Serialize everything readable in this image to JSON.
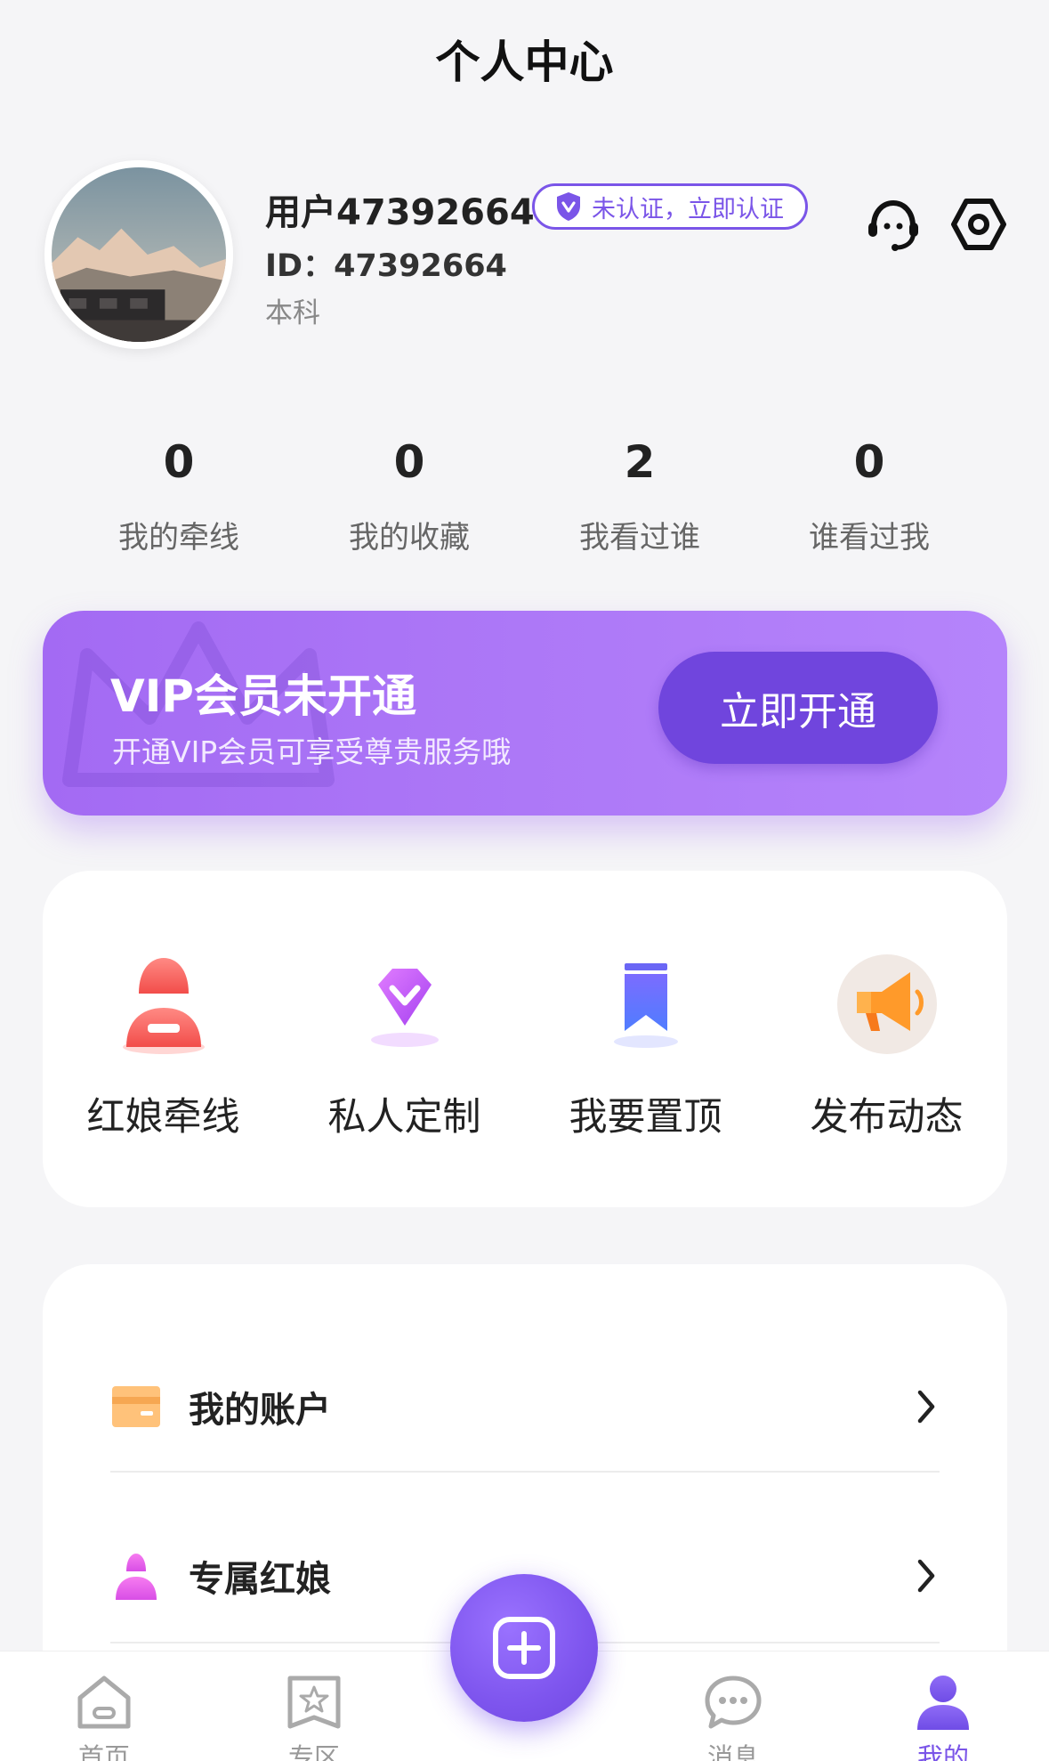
{
  "header": {
    "title": "个人中心"
  },
  "profile": {
    "name": "用户47392664",
    "verify_label": "未认证，立即认证",
    "id_text": "ID：47392664",
    "education": "本科"
  },
  "stats": [
    {
      "value": "0",
      "label": "我的牵线"
    },
    {
      "value": "0",
      "label": "我的收藏"
    },
    {
      "value": "2",
      "label": "我看过谁"
    },
    {
      "value": "0",
      "label": "谁看过我"
    }
  ],
  "vip": {
    "title": "VIP会员未开通",
    "subtitle": "开通VIP会员可享受尊贵服务哦",
    "button_label": "立即开通"
  },
  "quick_actions": [
    {
      "label": "红娘牵线",
      "icon": "matchmaker-icon"
    },
    {
      "label": "私人定制",
      "icon": "diamond-icon"
    },
    {
      "label": "我要置顶",
      "icon": "bookmark-icon"
    },
    {
      "label": "发布动态",
      "icon": "megaphone-icon"
    }
  ],
  "menu": [
    {
      "label": "我的账户",
      "icon": "wallet-icon"
    },
    {
      "label": "专属红娘",
      "icon": "matchmaker-icon"
    }
  ],
  "tabbar": [
    {
      "label": "首页",
      "icon": "home-icon",
      "active": false
    },
    {
      "label": "专区",
      "icon": "star-board-icon",
      "active": false
    },
    {
      "label": "消息",
      "icon": "chat-icon",
      "active": false
    },
    {
      "label": "我的",
      "icon": "person-icon",
      "active": true
    }
  ],
  "colors": {
    "accent": "#7a55e8",
    "vip_gradient_start": "#a36af3",
    "vip_button": "#7045dd",
    "background": "#f5f5f7"
  }
}
